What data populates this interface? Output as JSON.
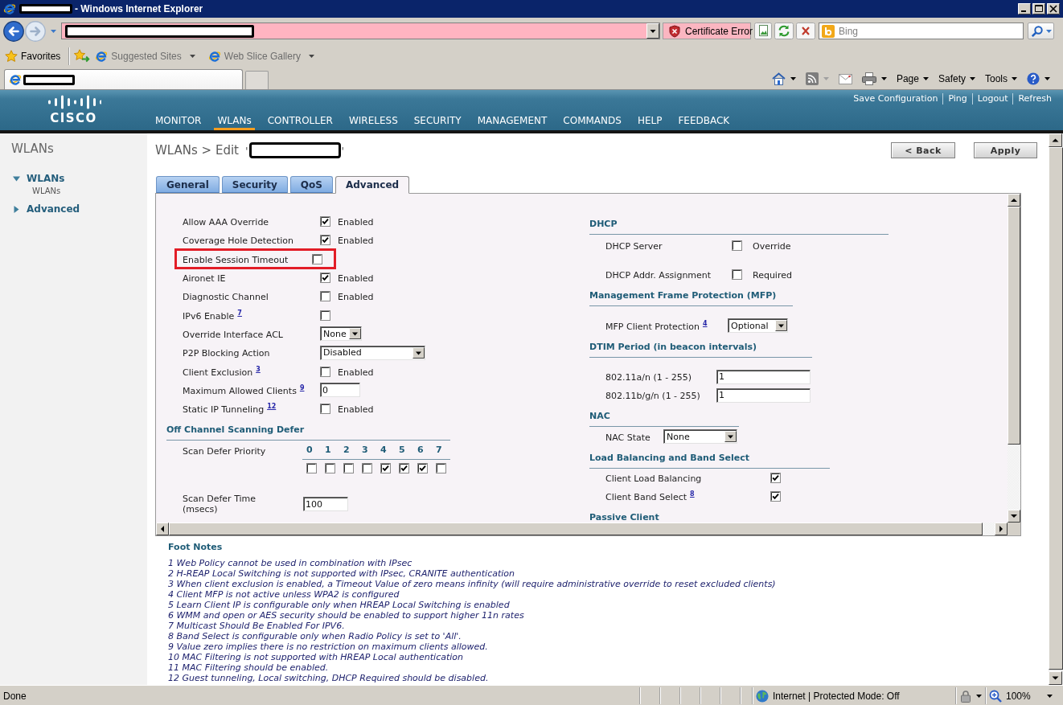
{
  "browser": {
    "title_bar": {
      "page_title_redacted": true,
      "title": "- Windows Internet Explorer"
    },
    "address_bar": {
      "url_redacted": true,
      "certificate_error": "Certificate Error",
      "search": {
        "placeholder": "Bing"
      }
    },
    "favorites_bar": {
      "favorites": "Favorites",
      "links": [
        "Suggested Sites",
        "Web Slice Gallery"
      ]
    },
    "tab": {
      "title_redacted": true
    },
    "command_bar": [
      "Page",
      "Safety",
      "Tools"
    ]
  },
  "header": {
    "logo_text": "CISCO",
    "links": [
      "Save Configuration",
      "Ping",
      "Logout",
      "Refresh"
    ],
    "nav": [
      {
        "label": "MONITOR",
        "selected": false
      },
      {
        "label": "WLANs",
        "selected": true
      },
      {
        "label": "CONTROLLER",
        "selected": false
      },
      {
        "label": "WIRELESS",
        "selected": false
      },
      {
        "label": "SECURITY",
        "selected": false
      },
      {
        "label": "MANAGEMENT",
        "selected": false
      },
      {
        "label": "COMMANDS",
        "selected": false
      },
      {
        "label": "HELP",
        "selected": false
      },
      {
        "label": "FEEDBACK",
        "selected": false
      }
    ]
  },
  "sidebar": {
    "heading": "WLANs",
    "tree": [
      {
        "label": "WLANs",
        "expanded": true,
        "children": [
          {
            "label": "WLANs"
          }
        ]
      },
      {
        "label": "Advanced",
        "expanded": false
      }
    ]
  },
  "page": {
    "breadcrumb": "WLANs > Edit",
    "quote_open": "'",
    "name_redacted": true,
    "quote_close": "'",
    "buttons": [
      "< Back",
      "Apply"
    ]
  },
  "tabs": [
    {
      "label": "General",
      "selected": false
    },
    {
      "label": "Security",
      "selected": false
    },
    {
      "label": "QoS",
      "selected": false
    },
    {
      "label": "Advanced",
      "selected": true
    }
  ],
  "left_rows": [
    {
      "kind": "checkbox",
      "label": "Allow AAA Override",
      "checked": true,
      "option": "Enabled",
      "highlighted": false
    },
    {
      "kind": "checkbox",
      "label": "Coverage Hole Detection",
      "checked": true,
      "option": "Enabled",
      "highlighted": false
    },
    {
      "kind": "checkbox",
      "label": "Enable Session Timeout",
      "checked": false,
      "highlighted": true
    },
    {
      "kind": "checkbox",
      "label": "Aironet IE",
      "checked": true,
      "option": "Enabled",
      "highlighted": false
    },
    {
      "kind": "checkbox",
      "label": "Diagnostic Channel",
      "checked": false,
      "option": "Enabled",
      "highlighted": false
    },
    {
      "kind": "checkbox",
      "label": "IPv6 Enable",
      "footnote": "7",
      "checked": false,
      "highlighted": false
    },
    {
      "kind": "select",
      "label": "Override Interface ACL",
      "value": "None",
      "highlighted": false
    },
    {
      "kind": "select",
      "label": "P2P Blocking Action",
      "value": "Disabled",
      "highlighted": false
    },
    {
      "kind": "checkbox",
      "label": "Client Exclusion",
      "footnote": "3",
      "checked": false,
      "option": "Enabled",
      "highlighted": false
    },
    {
      "kind": "input",
      "label": "Maximum Allowed Clients",
      "footnote": "9",
      "value": "0",
      "highlighted": false
    },
    {
      "kind": "checkbox",
      "label": "Static IP Tunneling",
      "footnote": "12",
      "checked": false,
      "option": "Enabled",
      "highlighted": false
    }
  ],
  "scan_defer": {
    "heading": "Off Channel Scanning Defer",
    "priority": {
      "label": "Scan Defer Priority",
      "levels": [
        {
          "label": "0",
          "checked": false
        },
        {
          "label": "1",
          "checked": false
        },
        {
          "label": "2",
          "checked": false
        },
        {
          "label": "3",
          "checked": false
        },
        {
          "label": "4",
          "checked": true
        },
        {
          "label": "5",
          "checked": true
        },
        {
          "label": "6",
          "checked": true
        },
        {
          "label": "7",
          "checked": false
        }
      ]
    },
    "time": {
      "label": "Scan Defer Time (msecs)",
      "value": "100"
    }
  },
  "right_sections": [
    {
      "heading": "DHCP",
      "rows": [
        {
          "kind": "checkbox",
          "label": "DHCP Server",
          "checked": false,
          "option": "Override"
        },
        {
          "kind": "checkbox",
          "label": "DHCP Addr. Assignment",
          "checked": false,
          "option": "Required"
        }
      ]
    },
    {
      "heading": "Management Frame Protection (MFP)",
      "rows": [
        {
          "kind": "select",
          "label": "MFP Client Protection",
          "footnote": "4",
          "value": "Optional"
        }
      ]
    },
    {
      "heading": "DTIM Period (in beacon intervals)",
      "rows": [
        {
          "kind": "input",
          "label": "802.11a/n (1 - 255)",
          "value": "1"
        },
        {
          "kind": "input",
          "label": "802.11b/g/n (1 - 255)",
          "value": "1"
        }
      ]
    },
    {
      "heading": "NAC",
      "rows": [
        {
          "kind": "select",
          "label": "NAC State",
          "value": "None"
        }
      ]
    },
    {
      "heading": "Load Balancing and Band Select",
      "rows": [
        {
          "kind": "checkbox",
          "label": "Client Load Balancing",
          "checked": true
        },
        {
          "kind": "checkbox",
          "label": "Client Band Select",
          "footnote": "8",
          "checked": true
        }
      ]
    },
    {
      "heading": "Passive Client"
    }
  ],
  "footnotes": {
    "heading": "Foot Notes",
    "items": [
      "1 Web Policy cannot be used in combination with IPsec",
      "2 H-REAP Local Switching is not supported with IPsec, CRANITE authentication",
      "3 When client exclusion is enabled, a Timeout Value of zero means infinity (will require administrative override to reset excluded clients)",
      "4 Client MFP is not active unless WPA2 is configured",
      "5 Learn Client IP is configurable only when HREAP Local Switching is enabled",
      "6 WMM and open or AES security should be enabled to support higher 11n rates",
      "7 Multicast Should Be Enabled For IPV6.",
      "8 Band Select is configurable only when Radio Policy is set to 'All'.",
      "9 Value zero implies there is no restriction on maximum clients allowed.",
      "10 MAC Filtering is not supported with HREAP Local authentication",
      "11 MAC Filtering should be enabled.",
      "12 Guest tunneling, Local switching, DHCP Required should be disabled."
    ]
  },
  "status_bar": {
    "status": "Done",
    "zone": "Internet | Protected Mode: Off",
    "zoom": "100%"
  }
}
